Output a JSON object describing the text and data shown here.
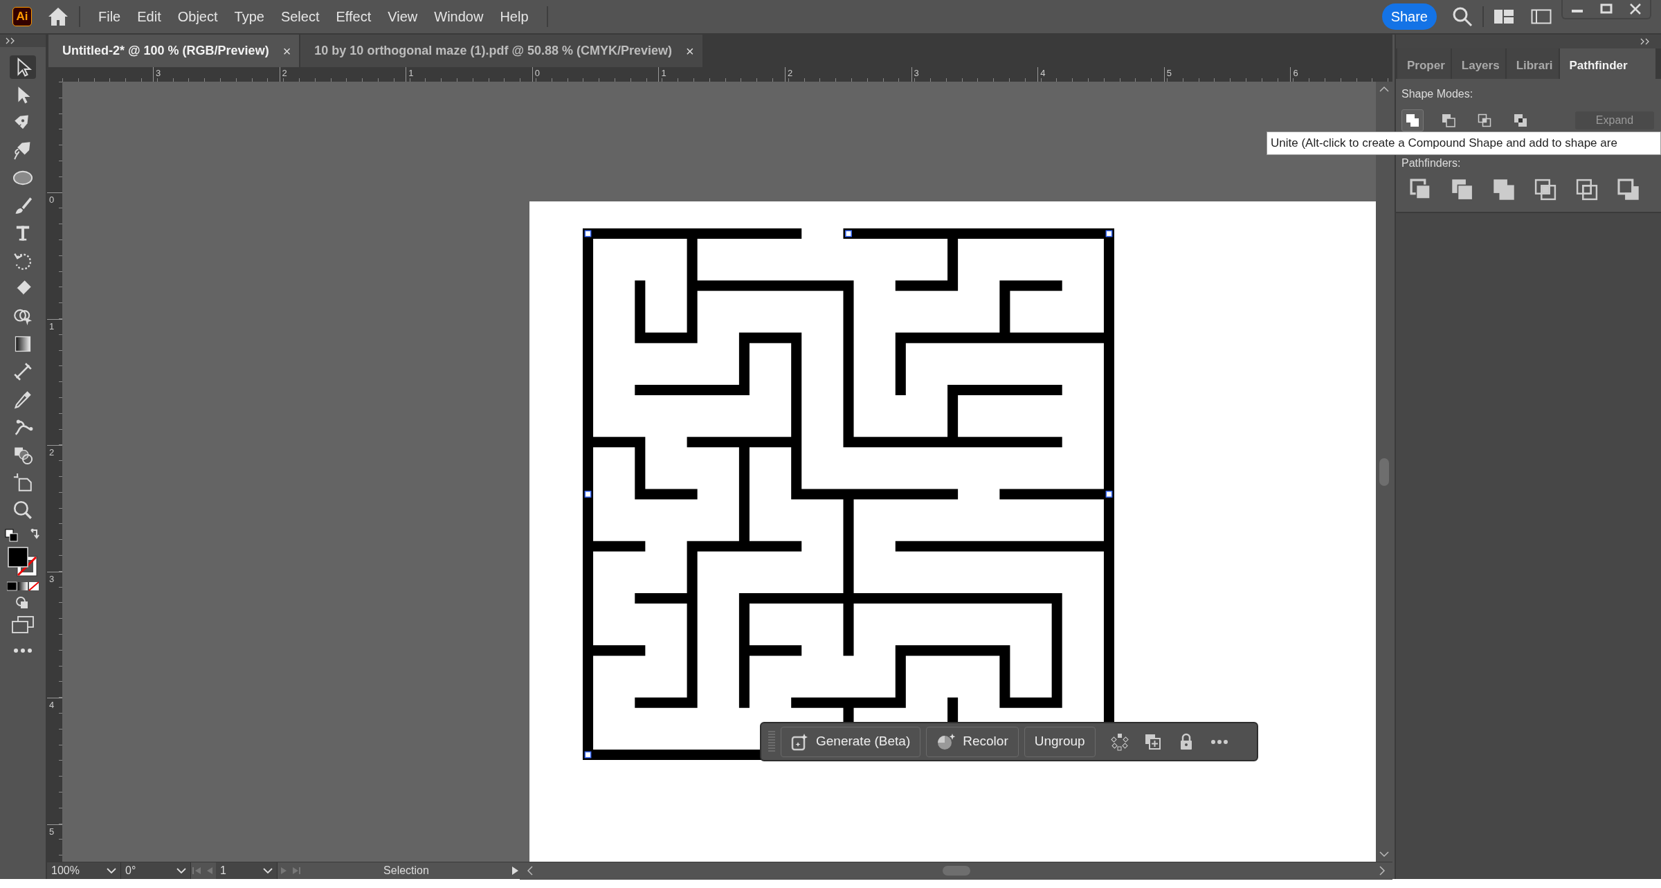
{
  "app": {
    "logo": "Ai",
    "menu": [
      "File",
      "Edit",
      "Object",
      "Type",
      "Select",
      "Effect",
      "View",
      "Window",
      "Help"
    ],
    "share": "Share"
  },
  "doc_tabs": [
    {
      "label": "Untitled-2* @ 100 % (RGB/Preview)",
      "selected": true,
      "close": "×"
    },
    {
      "label": "10 by 10 orthogonal maze (1).pdf @ 50.88 % (CMYK/Preview)",
      "selected": false,
      "close": "×"
    }
  ],
  "rulers": {
    "horizontal": [
      "3",
      "2",
      "1",
      "0",
      "1",
      "2",
      "3",
      "4",
      "5",
      "6"
    ],
    "vertical": [
      "0",
      "1",
      "2",
      "3",
      "4",
      "5"
    ]
  },
  "tools": [
    {
      "selected": true
    },
    {
      "selected": false
    },
    {
      "selected": false
    },
    {
      "selected": false
    },
    {
      "selected": false
    },
    {
      "selected": false
    },
    {
      "selected": false
    },
    {
      "selected": false
    },
    {
      "selected": false
    },
    {
      "selected": false
    },
    {
      "selected": false
    },
    {
      "selected": false
    },
    {
      "selected": false
    },
    {
      "selected": false
    },
    {
      "selected": false
    },
    {
      "selected": false
    },
    {
      "selected": false
    }
  ],
  "context_bar": {
    "buttons": [
      "Generate (Beta)",
      "Recolor",
      "Ungroup"
    ]
  },
  "status_bar": {
    "zoom": "100%",
    "rotation": "0°",
    "artboard": "1",
    "tool": "Selection"
  },
  "panel": {
    "tabs": [
      {
        "label": "Proper",
        "selected": false
      },
      {
        "label": "Layers",
        "selected": false
      },
      {
        "label": "Librari",
        "selected": false
      },
      {
        "label": "Pathfinder",
        "selected": true
      }
    ],
    "shape_modes_label": "Shape Modes:",
    "shape_modes": [
      {
        "selected": true
      },
      {
        "selected": false
      },
      {
        "selected": false
      },
      {
        "selected": false
      }
    ],
    "expand": {
      "label": "Expand",
      "disabled": true
    },
    "pathfinders_label": "Pathfinders:"
  },
  "tooltip": "Unite (Alt-click to create a Compound Shape and add to shape are"
}
